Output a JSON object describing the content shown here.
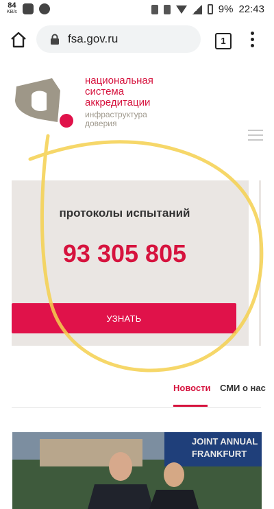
{
  "status_bar": {
    "net_speed": "84",
    "net_unit": "KB/s",
    "battery": "9%",
    "time": "22:43"
  },
  "browser": {
    "url": "fsa.gov.ru",
    "tab_count": "1"
  },
  "logo": {
    "line1": "национальная",
    "line2": "система",
    "line3": "аккредитации",
    "sub1": "инфраструктура",
    "sub2": "доверия"
  },
  "stats": {
    "label": "протоколы испытаний",
    "value": "93 305 805",
    "button_label": "УЗНАТЬ"
  },
  "tabs": [
    {
      "label": "Новости"
    },
    {
      "label": "СМИ о нас"
    }
  ],
  "news_photo": {
    "banner_lines": [
      "JOINT ANNUAL",
      "FRANKFURT"
    ]
  },
  "colors": {
    "accent": "#d6133e",
    "card_bg": "#eae6e3",
    "annotation": "#f4d04f"
  }
}
